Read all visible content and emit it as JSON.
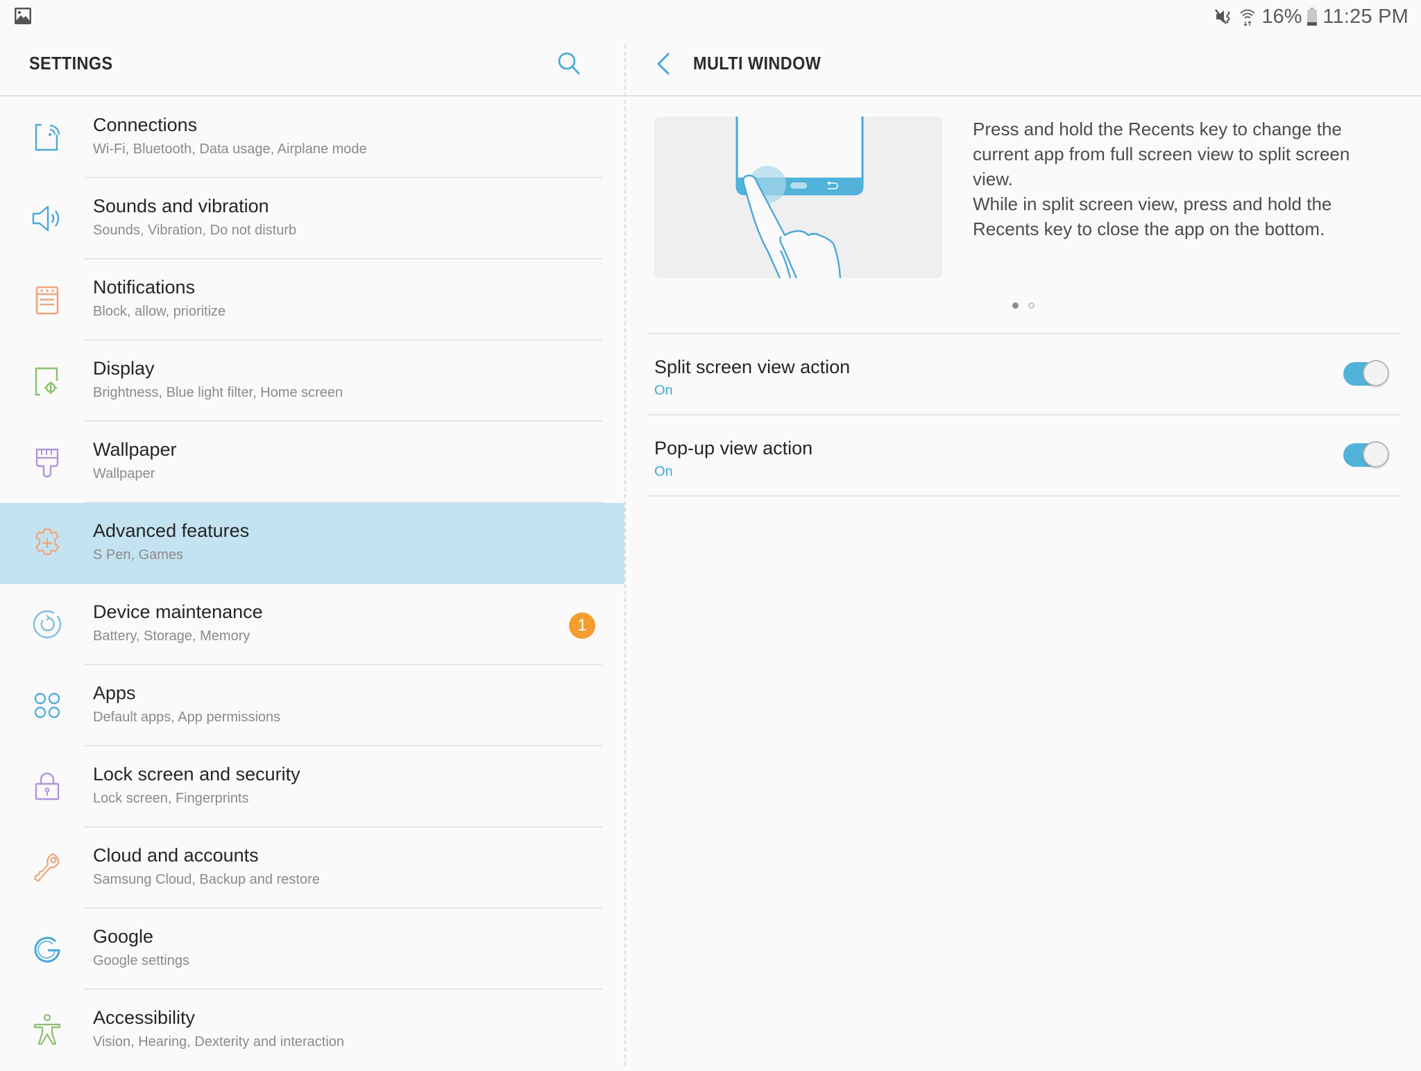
{
  "status_bar": {
    "left_icon": "gallery-image-icon",
    "mute_icon": "vibrate-mute-icon",
    "wifi_icon": "wifi-icon",
    "battery_percent": "16%",
    "battery_icon": "battery-icon",
    "time": "11:25 PM"
  },
  "left_header": {
    "title": "SETTINGS",
    "search_icon": "search-icon"
  },
  "colors": {
    "accent": "#3fa9d6",
    "selected_row": "#c3e3f0",
    "badge": "#f59c2e",
    "toggle_on": "#51b3d9"
  },
  "menu": [
    {
      "title": "Connections",
      "subtitle": "Wi-Fi, Bluetooth, Data usage, Airplane mode",
      "icon": "connections-icon",
      "color": "#4aa8d8"
    },
    {
      "title": "Sounds and vibration",
      "subtitle": "Sounds, Vibration, Do not disturb",
      "icon": "speaker-icon",
      "color": "#4aa8d8"
    },
    {
      "title": "Notifications",
      "subtitle": "Block, allow, prioritize",
      "icon": "notifications-icon",
      "color": "#f0a57c"
    },
    {
      "title": "Display",
      "subtitle": "Brightness, Blue light filter, Home screen",
      "icon": "display-icon",
      "color": "#8cbf6e"
    },
    {
      "title": "Wallpaper",
      "subtitle": "Wallpaper",
      "icon": "paintbrush-icon",
      "color": "#b194dc"
    },
    {
      "title": "Advanced features",
      "subtitle": "S Pen, Games",
      "icon": "gear-plus-icon",
      "color": "#f0a57c",
      "selected": true
    },
    {
      "title": "Device maintenance",
      "subtitle": "Battery, Storage, Memory",
      "icon": "maintenance-icon",
      "color": "#7dbfdc",
      "badge": "1"
    },
    {
      "title": "Apps",
      "subtitle": "Default apps, App permissions",
      "icon": "apps-icon",
      "color": "#4aa8d8"
    },
    {
      "title": "Lock screen and security",
      "subtitle": "Lock screen, Fingerprints",
      "icon": "lock-icon",
      "color": "#b194dc"
    },
    {
      "title": "Cloud and accounts",
      "subtitle": "Samsung Cloud, Backup and restore",
      "icon": "key-icon",
      "color": "#f0a57c"
    },
    {
      "title": "Google",
      "subtitle": "Google settings",
      "icon": "google-icon",
      "color": "#4aa8d8"
    },
    {
      "title": "Accessibility",
      "subtitle": "Vision, Hearing, Dexterity and interaction",
      "icon": "accessibility-icon",
      "color": "#8cbf6e"
    }
  ],
  "right_header": {
    "back_icon": "chevron-left-icon",
    "title": "MULTI WINDOW"
  },
  "tutorial": {
    "illustration": "press-recents-key-illustration",
    "description_line1": "Press and hold the Recents key to change the current app from full screen view to split screen view.",
    "description_line2": "While in split screen view, press and hold the Recents key to close the app on the bottom.",
    "page_count": 2,
    "current_page": 1
  },
  "settings": [
    {
      "title": "Split screen view action",
      "status": "On",
      "enabled": true
    },
    {
      "title": "Pop-up view action",
      "status": "On",
      "enabled": true
    }
  ]
}
